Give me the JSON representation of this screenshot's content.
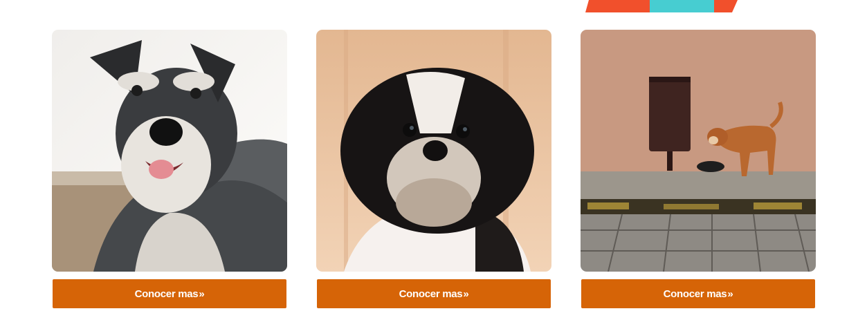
{
  "theme": {
    "button_color": "#D66407",
    "button_text_color": "#FFFFFF",
    "deco_red": "#F1502C",
    "deco_teal": "#47CDD1"
  },
  "cards": [
    {
      "image": "schnauzer-dog-photo",
      "button_label": "Conocer mas",
      "button_icon": "double-chevron-right-icon",
      "button_icon_glyph": "»"
    },
    {
      "image": "shih-tzu-dog-photo",
      "button_label": "Conocer mas",
      "button_icon": "double-chevron-right-icon",
      "button_icon_glyph": "»"
    },
    {
      "image": "street-dog-by-trash-can-photo",
      "button_label": "Conocer mas",
      "button_icon": "double-chevron-right-icon",
      "button_icon_glyph": "»"
    }
  ]
}
